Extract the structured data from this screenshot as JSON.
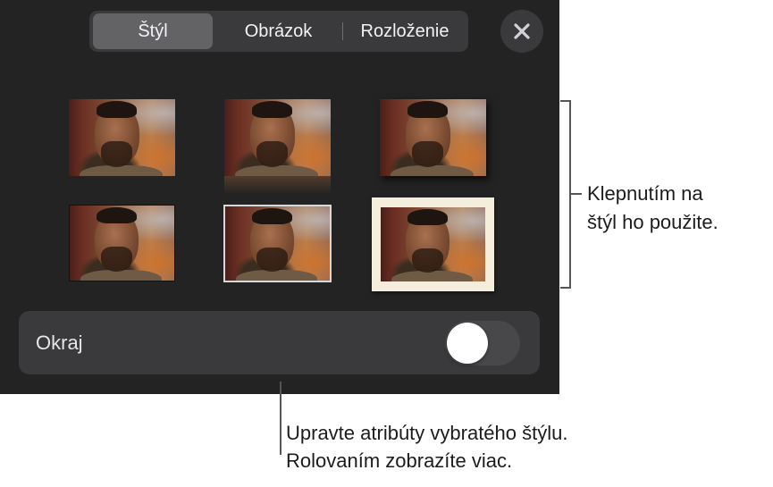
{
  "tabs": [
    {
      "label": "Štýl",
      "selected": true
    },
    {
      "label": "Obrázok",
      "selected": false
    },
    {
      "label": "Rozloženie",
      "selected": false
    }
  ],
  "close_button": {
    "icon": "close-icon"
  },
  "style_presets": [
    {
      "id": 1,
      "style": "plain"
    },
    {
      "id": 2,
      "style": "reflection"
    },
    {
      "id": 3,
      "style": "shadow"
    },
    {
      "id": 4,
      "style": "thin-dark-border"
    },
    {
      "id": 5,
      "style": "thin-light-border"
    },
    {
      "id": 6,
      "style": "cream-frame"
    }
  ],
  "border_setting": {
    "label": "Okraj",
    "enabled": false
  },
  "callouts": {
    "presets": [
      "Klepnutím na",
      "štýl ho použite."
    ],
    "attributes": [
      "Upravte atribúty vybratého štýlu.",
      "Rolovaním zobrazíte viac."
    ]
  },
  "colors": {
    "panel_bg": "#232323",
    "control_bg": "#3a3a3c",
    "selected_tab": "#636366",
    "cream_frame": "#f4efdd"
  }
}
